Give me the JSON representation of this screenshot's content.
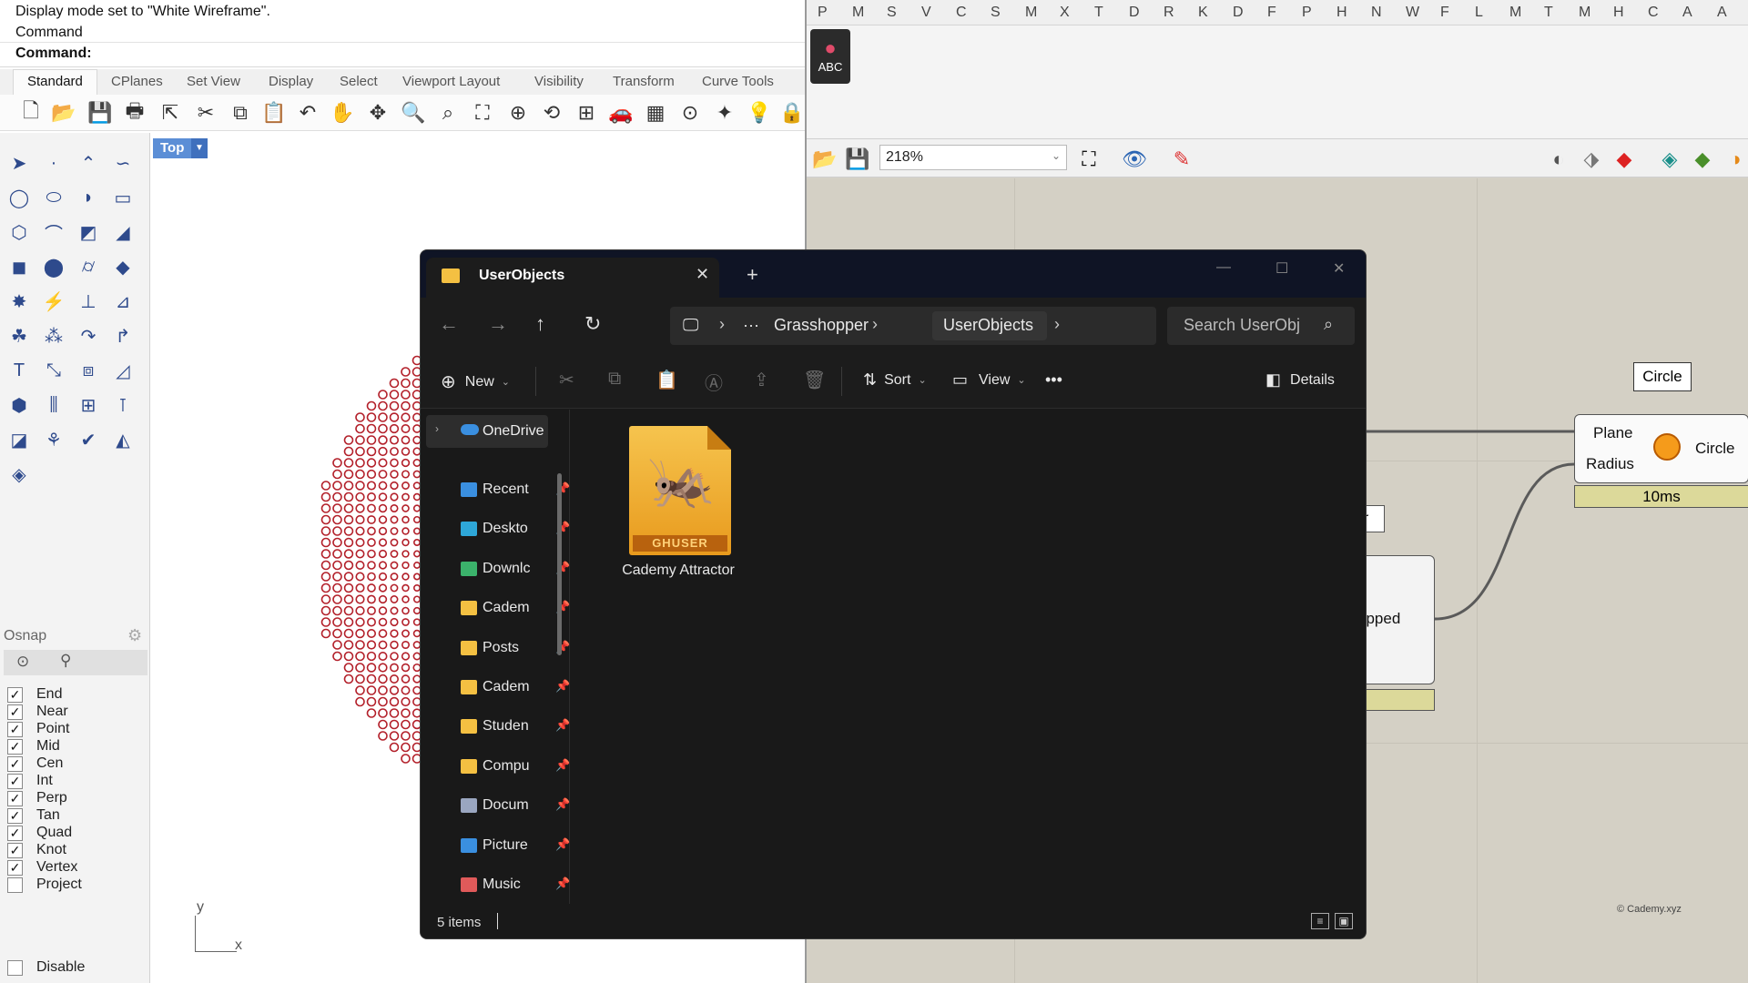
{
  "rhino": {
    "command_lines": [
      "Display mode set to \"White Wireframe\".",
      "Command",
      "Command:"
    ],
    "tabs": [
      "Standard",
      "CPlanes",
      "Set View",
      "Display",
      "Select",
      "Viewport Layout",
      "Visibility",
      "Transform",
      "Curve Tools"
    ],
    "viewport": {
      "label": "Top",
      "axis_y": "y",
      "axis_x": "x"
    },
    "osnap": {
      "title": "Osnap",
      "items": [
        {
          "label": "End",
          "checked": true
        },
        {
          "label": "Near",
          "checked": true
        },
        {
          "label": "Point",
          "checked": true
        },
        {
          "label": "Mid",
          "checked": true
        },
        {
          "label": "Cen",
          "checked": true
        },
        {
          "label": "Int",
          "checked": true
        },
        {
          "label": "Perp",
          "checked": true
        },
        {
          "label": "Tan",
          "checked": true
        },
        {
          "label": "Quad",
          "checked": true
        },
        {
          "label": "Knot",
          "checked": true
        },
        {
          "label": "Vertex",
          "checked": true
        },
        {
          "label": "Project",
          "checked": false
        }
      ],
      "disable_label": "Disable"
    }
  },
  "grasshopper": {
    "tab_letters": [
      "P",
      "M",
      "S",
      "V",
      "C",
      "S",
      "M",
      "X",
      "T",
      "D",
      "R",
      "K",
      "D",
      "F",
      "P",
      "H",
      "N",
      "W",
      "F",
      "L",
      "M",
      "T",
      "M",
      "H",
      "C",
      "A",
      "A"
    ],
    "abc_label": "ABC",
    "zoom": "218%",
    "circle_tag": "Circle",
    "circle_component": {
      "input1": "Plane",
      "input2": "Radius",
      "output": "Circle",
      "time": "10ms"
    },
    "mapped_label": "apped",
    "or_tag": "or",
    "copyright": "© Cademy.xyz"
  },
  "explorer": {
    "tab_title": "UserObjects",
    "breadcrumb": [
      "Grasshopper",
      "UserObjects"
    ],
    "breadcrumb_more": "···",
    "search_placeholder": "Search UserObj",
    "toolbar": {
      "new": "New",
      "sort": "Sort",
      "view": "View",
      "more": "•••",
      "details": "Details"
    },
    "nav": {
      "onedrive": "OneDrive",
      "items": [
        "Recent",
        "Deskto",
        "Downlc",
        "Cadem",
        "Posts",
        "Cadem",
        "Studen",
        "Compu",
        "Docum",
        "Picture",
        "Music"
      ]
    },
    "file": {
      "name": "Cademy Attractor",
      "badge": "GHUSER"
    },
    "status": "5 items"
  },
  "colors": {
    "explorer_bg": "#191919",
    "accent_folder": "#f4c042",
    "gh_canvas": "#d4d0c5",
    "dots": "#b3202a"
  }
}
